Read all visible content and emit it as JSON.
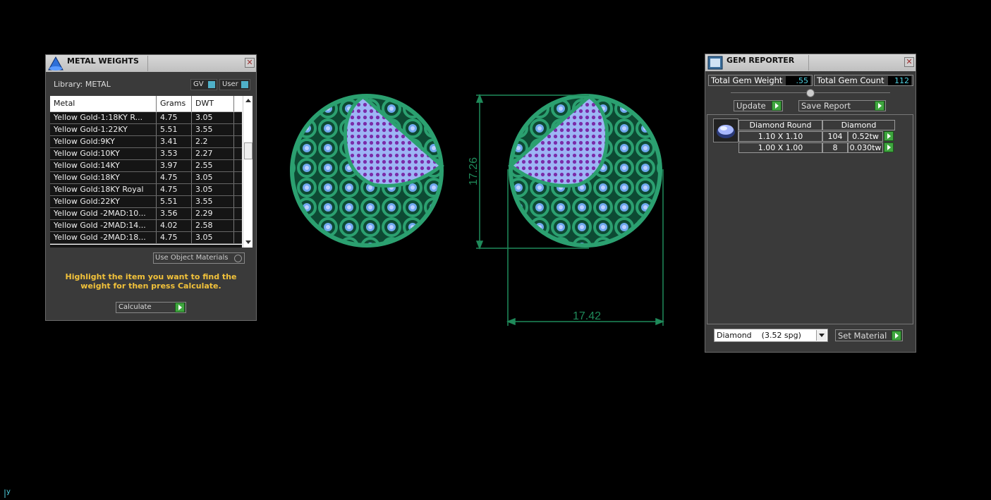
{
  "metal_weights": {
    "title": "METAL WEIGHTS",
    "library_label": "Library: METAL",
    "toggle_gv": "GV",
    "toggle_user": "User",
    "columns": [
      "Metal",
      "Grams",
      "DWT"
    ],
    "rows": [
      {
        "metal": "Yellow Gold-1:18KY R...",
        "grams": "4.75",
        "dwt": "3.05"
      },
      {
        "metal": "Yellow Gold-1:22KY",
        "grams": "5.51",
        "dwt": "3.55"
      },
      {
        "metal": "Yellow Gold:9KY",
        "grams": "3.41",
        "dwt": "2.2"
      },
      {
        "metal": "Yellow Gold:10KY",
        "grams": "3.53",
        "dwt": "2.27"
      },
      {
        "metal": "Yellow Gold:14KY",
        "grams": "3.97",
        "dwt": "2.55"
      },
      {
        "metal": "Yellow Gold:18KY",
        "grams": "4.75",
        "dwt": "3.05"
      },
      {
        "metal": "Yellow Gold:18KY Royal",
        "grams": "4.75",
        "dwt": "3.05"
      },
      {
        "metal": "Yellow Gold:22KY",
        "grams": "5.51",
        "dwt": "3.55"
      },
      {
        "metal": "Yellow Gold -2MAD:10...",
        "grams": "3.56",
        "dwt": "2.29"
      },
      {
        "metal": "Yellow Gold -2MAD:14...",
        "grams": "4.02",
        "dwt": "2.58"
      },
      {
        "metal": "Yellow Gold -2MAD:18...",
        "grams": "4.75",
        "dwt": "3.05"
      }
    ],
    "use_object_materials": "Use Object Materials",
    "hint": "Highlight the item you want to find the weight for then press Calculate.",
    "calculate_label": "Calculate"
  },
  "gem_reporter": {
    "title": "GEM REPORTER",
    "total_weight_label": "Total Gem Weight",
    "total_weight_value": ".55",
    "total_count_label": "Total Gem Count",
    "total_count_value": "112",
    "update_label": "Update",
    "save_report_label": "Save Report",
    "table_header": [
      "Diamond Round",
      "Diamond"
    ],
    "gems": [
      {
        "size": "1.10 X 1.10",
        "count": "104",
        "weight": "0.52tw"
      },
      {
        "size": "1.00 X 1.00",
        "count": "8",
        "weight": "0.030tw"
      }
    ],
    "material_select": "Diamond    (3.52 spg)",
    "set_material_label": "Set Material"
  },
  "viewport": {
    "dim_height": "17.26",
    "dim_width": "17.42",
    "axis_label": "y",
    "colors": {
      "metal": "#1f8a5a",
      "gem": "#8ea8f0",
      "gem_dark": "#7a2ba8",
      "dim_line": "#1f8a5a"
    }
  }
}
